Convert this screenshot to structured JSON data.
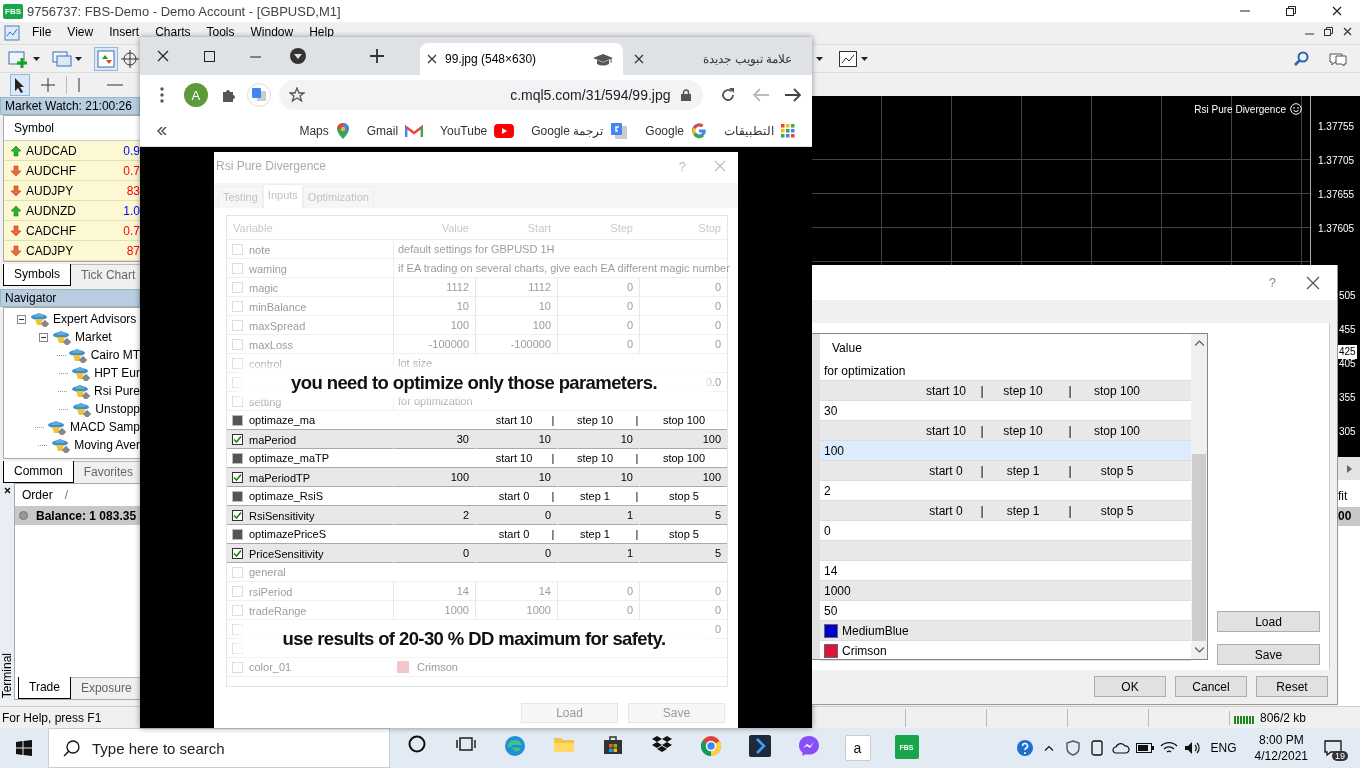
{
  "mt4": {
    "logo": "FBS",
    "title": "9756737: FBS-Demo - Demo Account - [GBPUSD,M1]",
    "menu": [
      "File",
      "View",
      "Insert",
      "Charts",
      "Tools",
      "Window",
      "Help"
    ],
    "market_watch": {
      "title": "Market Watch: 21:00:26",
      "column": "Symbol",
      "rows": [
        {
          "symbol": "AUDCAD",
          "price": "0.9",
          "up": true
        },
        {
          "symbol": "AUDCHF",
          "price": "0.7",
          "up": false
        },
        {
          "symbol": "AUDJPY",
          "price": "83",
          "up": false
        },
        {
          "symbol": "AUDNZD",
          "price": "1.0",
          "up": true
        },
        {
          "symbol": "CADCHF",
          "price": "0.7",
          "up": false
        },
        {
          "symbol": "CADJPY",
          "price": "87",
          "up": false
        }
      ],
      "tabs": [
        {
          "label": "Symbols",
          "selected": true
        },
        {
          "label": "Tick Chart",
          "selected": false
        }
      ]
    },
    "navigator": {
      "title": "Navigator",
      "tree": [
        {
          "label": "Expert Advisors",
          "expanded": true,
          "children": [
            {
              "label": "Market",
              "expanded": true,
              "children": [
                {
                  "label": "Cairo MT"
                },
                {
                  "label": "HPT Eur"
                },
                {
                  "label": "Rsi Pure"
                },
                {
                  "label": "Unstopp"
                }
              ]
            },
            {
              "label": "MACD Samp"
            },
            {
              "label": "Moving Aver"
            }
          ]
        }
      ],
      "tabs": [
        {
          "label": "Common",
          "selected": true
        },
        {
          "label": "Favorites",
          "selected": false
        }
      ]
    },
    "terminal": {
      "title": "Terminal",
      "columns": [
        "Order",
        "/"
      ],
      "balance": "Balance: 1 083.35",
      "tabs": [
        {
          "label": "Trade",
          "selected": true
        },
        {
          "label": "Exposure",
          "selected": false
        }
      ]
    },
    "chart": {
      "indicator": "Rsi Pure Divergence",
      "prices": [
        {
          "text": "1.37755",
          "current": false
        },
        {
          "text": "1.37705",
          "current": false
        },
        {
          "text": "1.37655",
          "current": false
        },
        {
          "text": "1.37605",
          "current": false
        }
      ],
      "prices_cut": [
        {
          "text": "505",
          "current": false
        },
        {
          "text": "455",
          "current": false
        },
        {
          "text": "425",
          "current": true
        },
        {
          "text": "405",
          "current": false
        },
        {
          "text": "355",
          "current": false
        },
        {
          "text": "305",
          "current": false
        }
      ],
      "terminal_column": "fit",
      "terminal_value": "00"
    },
    "status_bar": {
      "help": "For Help, press F1",
      "traffic": "806/2 kb"
    }
  },
  "browser": {
    "tabs": [
      {
        "title": "99.jpg (548×630)",
        "selected": true
      },
      {
        "title": "علامة تبويب جديدة",
        "selected": false
      }
    ],
    "profile": "A",
    "url": "c.mql5.com/31/594/99.jpg",
    "bookmarks": [
      {
        "label": "Maps"
      },
      {
        "label": "Gmail"
      },
      {
        "label": "YouTube"
      },
      {
        "label": "Google ترجمة"
      },
      {
        "label": "Google"
      },
      {
        "label": "التطبيقات"
      }
    ],
    "image": {
      "title": "Rsi Pure Divergence",
      "help": "?",
      "tabs": [
        {
          "label": "Testing",
          "selected": false
        },
        {
          "label": "Inputs",
          "selected": true
        },
        {
          "label": "Optimization",
          "selected": false
        }
      ],
      "columns": [
        "Variable",
        "Value",
        "Start",
        "Step",
        "Stop"
      ],
      "rows": [
        {
          "kind": "text",
          "name": "note",
          "faded": true,
          "checked": false,
          "value": "default settings for GBPUSD 1H"
        },
        {
          "kind": "text",
          "name": "waming",
          "faded": true,
          "checked": false,
          "value": "if EA trading on several charts, give each EA different magic number"
        },
        {
          "kind": "param",
          "name": "magic",
          "faded": true,
          "checked": false,
          "value": "1112",
          "start": "1112",
          "step": "0",
          "stop": "0"
        },
        {
          "kind": "param",
          "name": "minBalance",
          "faded": true,
          "checked": false,
          "value": "10",
          "start": "10",
          "step": "0",
          "stop": "0"
        },
        {
          "kind": "param",
          "name": "maxSpread",
          "faded": true,
          "checked": false,
          "value": "100",
          "start": "100",
          "step": "0",
          "stop": "0"
        },
        {
          "kind": "param",
          "name": "maxLoss",
          "faded": true,
          "checked": false,
          "value": "-100000",
          "start": "-100000",
          "step": "0",
          "stop": "0"
        },
        {
          "kind": "text",
          "name": "control",
          "faded": true,
          "checked": false,
          "value": "lot size"
        },
        {
          "kind": "covered",
          "faded": true,
          "checked": false,
          "stop": "0.0"
        },
        {
          "kind": "text",
          "name": "setting",
          "faded": true,
          "checked": false,
          "value": "for optimization"
        },
        {
          "kind": "group",
          "name": "optimaze_ma",
          "faded": false,
          "checked": false,
          "cells": [
            "start 10",
            "|",
            "step 10",
            "|",
            "stop 100"
          ]
        },
        {
          "kind": "param",
          "name": "maPeriod",
          "faded": false,
          "checked": true,
          "value": "30",
          "start": "10",
          "step": "10",
          "stop": "100"
        },
        {
          "kind": "group",
          "name": "optimaze_maTP",
          "faded": false,
          "checked": false,
          "cells": [
            "start 10",
            "|",
            "step 10",
            "|",
            "stop 100"
          ]
        },
        {
          "kind": "param",
          "name": "maPeriodTP",
          "faded": false,
          "checked": true,
          "value": "100",
          "start": "10",
          "step": "10",
          "stop": "100"
        },
        {
          "kind": "group",
          "name": "optimaze_RsiS",
          "faded": false,
          "checked": false,
          "cells": [
            "start 0",
            "|",
            "step 1",
            "|",
            "stop 5"
          ]
        },
        {
          "kind": "param",
          "name": "RsiSensitivity",
          "faded": false,
          "checked": true,
          "value": "2",
          "start": "0",
          "step": "1",
          "stop": "5"
        },
        {
          "kind": "group",
          "name": "optimazePriceS",
          "faded": false,
          "checked": false,
          "cells": [
            "start 0",
            "|",
            "step 1",
            "|",
            "stop 5"
          ]
        },
        {
          "kind": "param",
          "name": "PriceSensitivity",
          "faded": false,
          "checked": true,
          "value": "0",
          "start": "0",
          "step": "1",
          "stop": "5"
        },
        {
          "kind": "text",
          "name": "general",
          "faded": true,
          "checked": false
        },
        {
          "kind": "param",
          "name": "rsiPeriod",
          "faded": true,
          "checked": false,
          "value": "14",
          "start": "14",
          "step": "0",
          "stop": "0"
        },
        {
          "kind": "param",
          "name": "tradeRange",
          "faded": true,
          "checked": false,
          "value": "1000",
          "start": "1000",
          "step": "0",
          "stop": "0"
        },
        {
          "kind": "covered",
          "faded": true,
          "checked": false,
          "stop": "0"
        },
        {
          "kind": "covered",
          "faded": true,
          "checked": false
        },
        {
          "kind": "color",
          "name": "color_01",
          "faded": true,
          "checked": false,
          "value": "Crimson",
          "color": "#f4c4cd"
        }
      ],
      "notes": [
        "you need to optimize only those parameters.",
        "use results of 20-30 % DD maximum for safety."
      ],
      "buttons": [
        "Load",
        "Save"
      ]
    }
  },
  "dialog": {
    "help": "?",
    "column": "Value",
    "rows": [
      {
        "kind": "text",
        "value": "for optimization",
        "selected": false
      },
      {
        "kind": "group",
        "cells": [
          "start 10",
          "|",
          "step 10",
          "|",
          "stop 100"
        ],
        "selected": false
      },
      {
        "kind": "text",
        "value": "30",
        "selected": false
      },
      {
        "kind": "group",
        "cells": [
          "start 10",
          "|",
          "step 10",
          "|",
          "stop 100"
        ],
        "selected": false
      },
      {
        "kind": "text",
        "value": "100",
        "selected": true
      },
      {
        "kind": "group",
        "cells": [
          "start 0",
          "|",
          "step 1",
          "|",
          "stop 5"
        ],
        "selected": false
      },
      {
        "kind": "text",
        "value": "2",
        "selected": false
      },
      {
        "kind": "group",
        "cells": [
          "start 0",
          "|",
          "step 1",
          "|",
          "stop 5"
        ],
        "selected": false
      },
      {
        "kind": "text",
        "value": "0",
        "selected": false
      },
      {
        "kind": "text",
        "selected": false
      },
      {
        "kind": "text",
        "value": "14",
        "selected": false
      },
      {
        "kind": "text",
        "value": "1000",
        "selected": false
      },
      {
        "kind": "text",
        "value": "50",
        "selected": false
      },
      {
        "kind": "color",
        "value": "MediumBlue",
        "color": "#0000cd",
        "selected": false
      },
      {
        "kind": "color",
        "value": "Crimson",
        "color": "#dc143c",
        "selected": false
      }
    ],
    "side_buttons": [
      "Load",
      "Save"
    ],
    "buttons": [
      "OK",
      "Cancel",
      "Reset"
    ]
  },
  "taskbar": {
    "search_placeholder": "Type here to search",
    "app_labels": [
      "a",
      "FBS"
    ],
    "language": "ENG",
    "time": "8:00 PM",
    "date": "4/12/2021",
    "notifications": "19"
  }
}
